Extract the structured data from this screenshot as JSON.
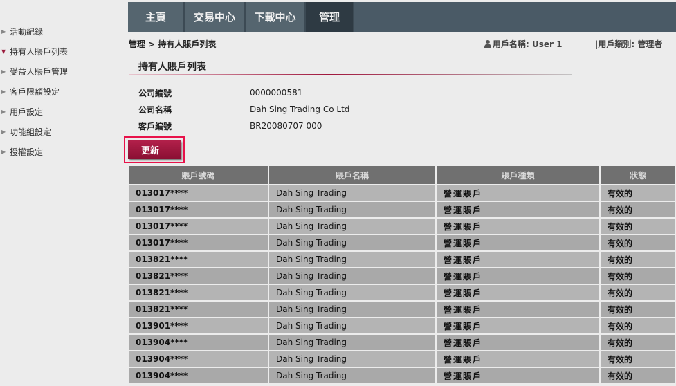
{
  "sidebar": {
    "items": [
      {
        "label": "活動紀錄",
        "active": false
      },
      {
        "label": "持有人賬戶列表",
        "active": true
      },
      {
        "label": "受益人賬戶管理",
        "active": false
      },
      {
        "label": "客戶限額設定",
        "active": false
      },
      {
        "label": "用戶設定",
        "active": false
      },
      {
        "label": "功能組設定",
        "active": false
      },
      {
        "label": "授權設定",
        "active": false
      }
    ]
  },
  "nav": {
    "tabs": [
      {
        "label": "主頁",
        "active": false
      },
      {
        "label": "交易中心",
        "active": false
      },
      {
        "label": "下載中心",
        "active": false
      },
      {
        "label": "管理",
        "active": true
      }
    ]
  },
  "breadcrumb": "管理 > 持有人賬戶列表",
  "user": {
    "name_text": "用戶名稱: User 1",
    "type_text": "|用戶類別: 管理者"
  },
  "section": {
    "title": "持有人賬戶列表"
  },
  "info": {
    "rows": [
      {
        "label": "公司編號",
        "value": "0000000581"
      },
      {
        "label": "公司名稱",
        "value": "Dah Sing Trading Co Ltd"
      },
      {
        "label": "客戶編號",
        "value": "BR20080707 000"
      }
    ]
  },
  "update_button": "更新",
  "table": {
    "headers": [
      "賬戶號碼",
      "賬戶名稱",
      "賬戶種類",
      "狀態"
    ],
    "rows": [
      [
        "013017****",
        "Dah Sing Trading",
        "營運賬戶",
        "有效的"
      ],
      [
        "013017****",
        "Dah Sing Trading",
        "營運賬戶",
        "有效的"
      ],
      [
        "013017****",
        "Dah Sing Trading",
        "營運賬戶",
        "有效的"
      ],
      [
        "013017****",
        "Dah Sing Trading",
        "營運賬戶",
        "有效的"
      ],
      [
        "013821****",
        "Dah Sing Trading",
        "營運賬戶",
        "有效的"
      ],
      [
        "013821****",
        "Dah Sing Trading",
        "營運賬戶",
        "有效的"
      ],
      [
        "013821****",
        "Dah Sing Trading",
        "營運賬戶",
        "有效的"
      ],
      [
        "013821****",
        "Dah Sing Trading",
        "營運賬戶",
        "有效的"
      ],
      [
        "013901****",
        "Dah Sing Trading",
        "營運賬戶",
        "有效的"
      ],
      [
        "013904****",
        "Dah Sing Trading",
        "營運賬戶",
        "有效的"
      ],
      [
        "013904****",
        "Dah Sing Trading",
        "營運賬戶",
        "有效的"
      ],
      [
        "013904****",
        "Dah Sing Trading",
        "營運賬戶",
        "有效的"
      ]
    ]
  },
  "colors": {
    "accent": "#9a1b3c",
    "nav_bg": "#4a5a66",
    "highlight_border": "#e8124a"
  }
}
